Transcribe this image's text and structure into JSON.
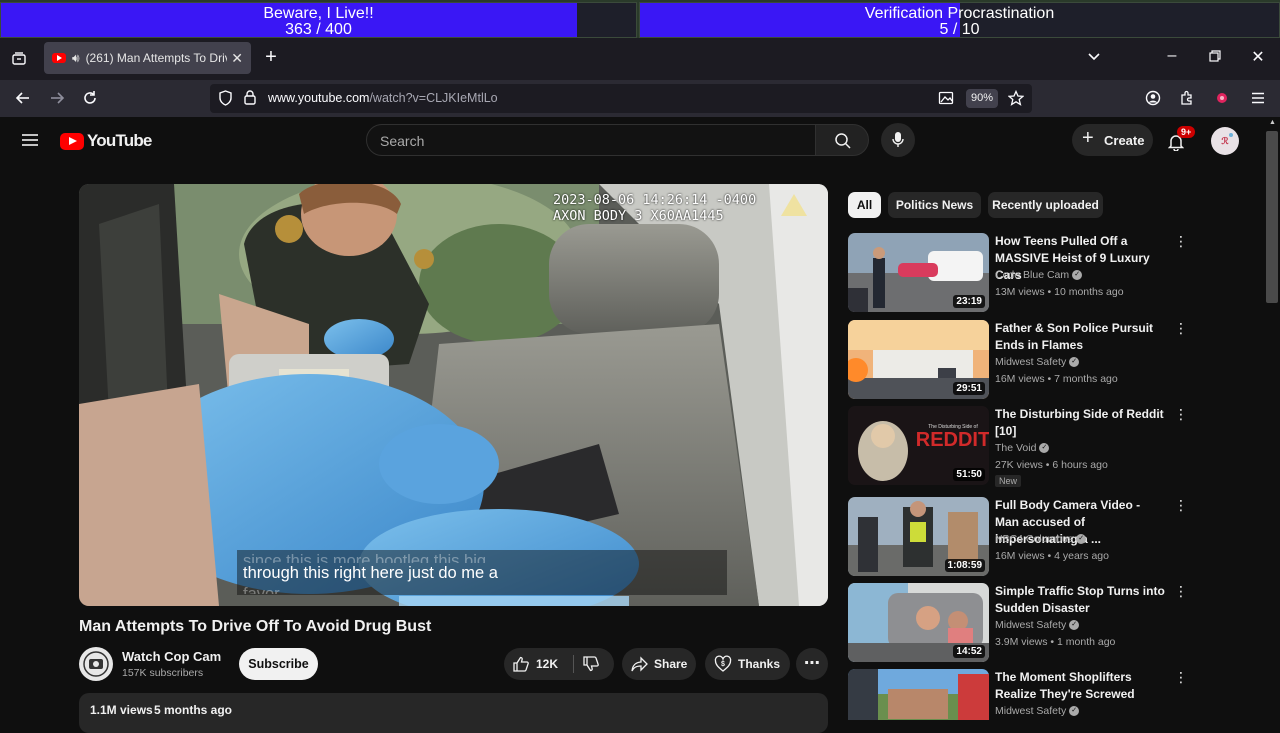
{
  "overlay": {
    "bar1_title": "Beware, I Live!!",
    "bar1_progress": "363 / 400",
    "bar1_fraction": 0.9075,
    "bar2_title": "Verification Procrastination",
    "bar2_progress": "5 / 10",
    "bar2_fraction": 0.5
  },
  "browser": {
    "tab_title": "(261) Man Attempts To Driv",
    "url_host": "www.youtube.com",
    "url_path": "/watch?v=CLJKIeMtlLo",
    "zoom": "90%"
  },
  "masthead": {
    "logo_text": "YouTube",
    "search_placeholder": "Search",
    "create_label": "Create",
    "notif_count": "9+"
  },
  "player": {
    "overlay_line1": "2023-08-06 14:26:14 -0400",
    "overlay_line2": "AXON BODY 3 X60AA1445",
    "caption_line1": "since this is more bootleg this big",
    "caption_line2": "through this right here just do me a",
    "caption_line3": "favor"
  },
  "video": {
    "title": "Man Attempts To Drive Off To Avoid Drug Bust",
    "channel_name": "Watch Cop Cam",
    "subscribers": "157K subscribers",
    "subscribe_label": "Subscribe",
    "likes": "12K",
    "share_label": "Share",
    "thanks_label": "Thanks",
    "views": "1.1M views",
    "age": "5 months ago"
  },
  "chips": [
    "All",
    "Politics News",
    "Recently uploaded"
  ],
  "recommendations": [
    {
      "title": "How Teens Pulled Off a MASSIVE Heist of 9 Luxury Cars",
      "channel": "Code Blue Cam",
      "meta": "13M views • 10 months ago",
      "duration": "23:19",
      "badge": ""
    },
    {
      "title": "Father & Son Police Pursuit Ends in Flames",
      "channel": "Midwest Safety",
      "meta": "16M views • 7 months ago",
      "duration": "29:51",
      "badge": ""
    },
    {
      "title": "The Disturbing Side of Reddit [10]",
      "channel": "The Void",
      "meta": "27K views • 6 hours ago",
      "duration": "51:50",
      "badge": "New"
    },
    {
      "title": "Full Body Camera Video - Man accused of impersonating a ...",
      "channel": "NBC4 Columbus",
      "meta": "16M views • 4 years ago",
      "duration": "1:08:59",
      "badge": ""
    },
    {
      "title": "Simple Traffic Stop Turns into Sudden Disaster",
      "channel": "Midwest Safety",
      "meta": "3.9M views • 1 month ago",
      "duration": "14:52",
      "badge": ""
    },
    {
      "title": "The Moment Shoplifters Realize They're Screwed",
      "channel": "Midwest Safety",
      "meta": "",
      "duration": "",
      "badge": ""
    }
  ],
  "thumb_text": {
    "reddit_word": "REDDIT",
    "reddit_sub": "The Disturbing Side of"
  }
}
